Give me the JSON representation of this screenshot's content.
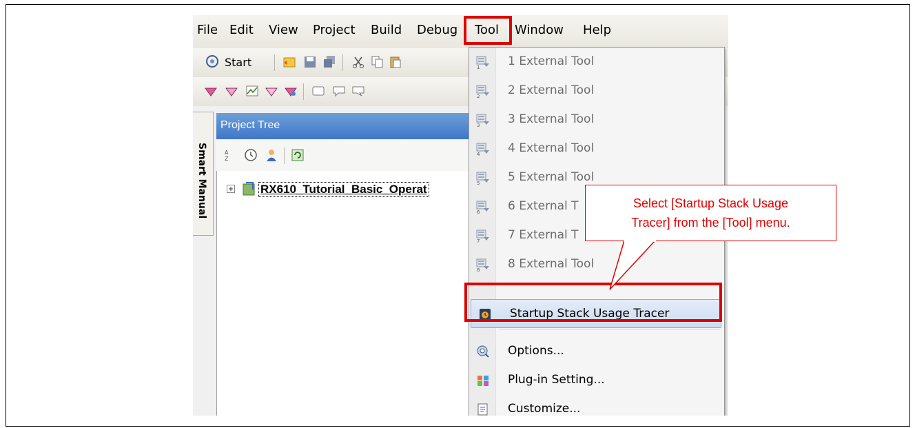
{
  "menubar": {
    "items": [
      "File",
      "Edit",
      "View",
      "Project",
      "Build",
      "Debug",
      "Tool",
      "Window",
      "Help"
    ]
  },
  "toolbar": {
    "start_label": "Start"
  },
  "side_tab": {
    "label": "Smart Manual"
  },
  "project_tree": {
    "title": "Project Tree",
    "root_item": "RX610_Tutorial_Basic_Operat"
  },
  "tool_menu": {
    "items": [
      {
        "label": "1 External Tool",
        "enabled": false,
        "icon": "external-tool-icon"
      },
      {
        "label": "2 External Tool",
        "enabled": false,
        "icon": "external-tool-icon"
      },
      {
        "label": "3 External Tool",
        "enabled": false,
        "icon": "external-tool-icon"
      },
      {
        "label": "4 External Tool",
        "enabled": false,
        "icon": "external-tool-icon"
      },
      {
        "label": "5 External Tool",
        "enabled": false,
        "icon": "external-tool-icon"
      },
      {
        "label": "6 External T",
        "enabled": false,
        "icon": "external-tool-icon"
      },
      {
        "label": "7 External T",
        "enabled": false,
        "icon": "external-tool-icon"
      },
      {
        "label": "8 External Tool",
        "enabled": false,
        "icon": "external-tool-icon"
      },
      {
        "label": "Startup Stack Usage Tracer",
        "enabled": true,
        "icon": "stack-tracer-icon"
      },
      {
        "label": "Options...",
        "enabled": true,
        "icon": "options-icon"
      },
      {
        "label": "Plug-in Setting...",
        "enabled": true,
        "icon": "plugin-icon"
      },
      {
        "label": "Customize...",
        "enabled": true,
        "icon": "customize-icon"
      }
    ]
  },
  "callout": {
    "line1": "Select [Startup Stack Usage",
    "line2": "Tracer] from the [Tool] menu."
  },
  "colors": {
    "highlight": "#e00000",
    "titlebar": "#3f77c8"
  }
}
